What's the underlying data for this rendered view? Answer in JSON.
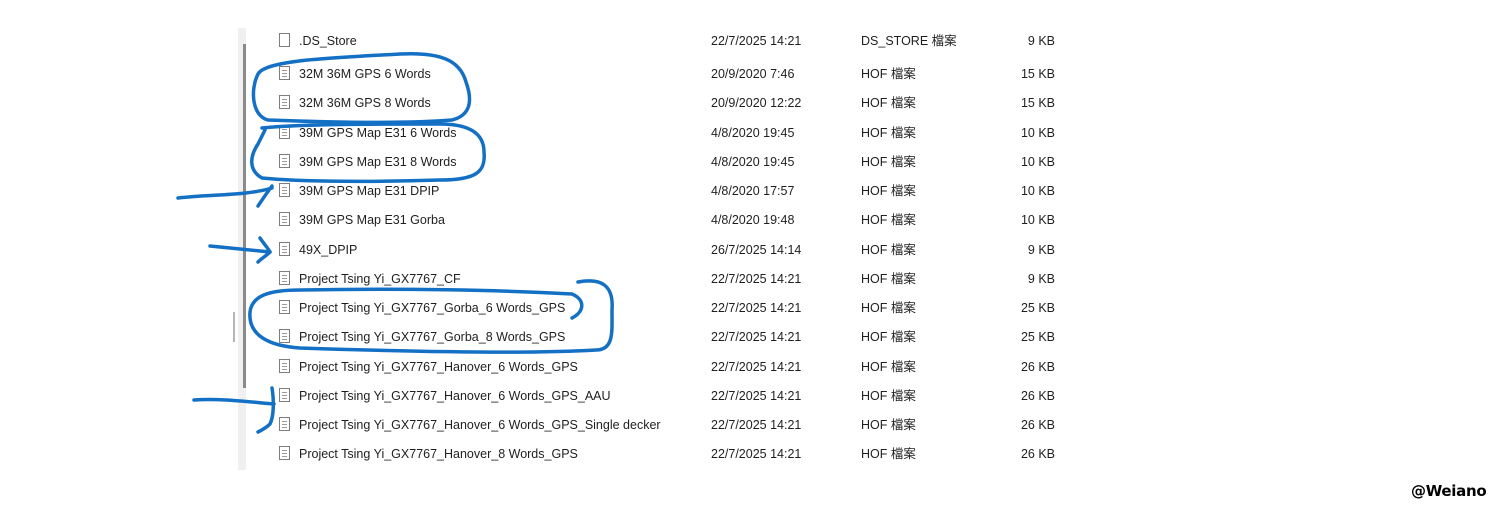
{
  "files": [
    {
      "name": ".DS_Store",
      "date": "22/7/2025 14:21",
      "type": "DS_STORE 檔案",
      "size": "9 KB",
      "icon": "blank-file-icon"
    },
    {
      "name": "32M 36M GPS 6 Words",
      "date": "20/9/2020 7:46",
      "type": "HOF 檔案",
      "size": "15 KB",
      "icon": "text-file-icon"
    },
    {
      "name": "32M 36M GPS 8 Words",
      "date": "20/9/2020 12:22",
      "type": "HOF 檔案",
      "size": "15 KB",
      "icon": "text-file-icon"
    },
    {
      "name": "39M GPS Map E31 6 Words",
      "date": "4/8/2020 19:45",
      "type": "HOF 檔案",
      "size": "10 KB",
      "icon": "text-file-icon"
    },
    {
      "name": "39M GPS Map E31 8 Words",
      "date": "4/8/2020 19:45",
      "type": "HOF 檔案",
      "size": "10 KB",
      "icon": "text-file-icon"
    },
    {
      "name": "39M GPS Map E31 DPIP",
      "date": "4/8/2020 17:57",
      "type": "HOF 檔案",
      "size": "10 KB",
      "icon": "text-file-icon"
    },
    {
      "name": "39M GPS Map E31 Gorba",
      "date": "4/8/2020 19:48",
      "type": "HOF 檔案",
      "size": "10 KB",
      "icon": "text-file-icon"
    },
    {
      "name": "49X_DPIP",
      "date": "26/7/2025 14:14",
      "type": "HOF 檔案",
      "size": "9 KB",
      "icon": "text-file-icon"
    },
    {
      "name": "Project Tsing Yi_GX7767_CF",
      "date": "22/7/2025 14:21",
      "type": "HOF 檔案",
      "size": "9 KB",
      "icon": "text-file-icon"
    },
    {
      "name": "Project Tsing Yi_GX7767_Gorba_6 Words_GPS",
      "date": "22/7/2025 14:21",
      "type": "HOF 檔案",
      "size": "25 KB",
      "icon": "text-file-icon"
    },
    {
      "name": "Project Tsing Yi_GX7767_Gorba_8 Words_GPS",
      "date": "22/7/2025 14:21",
      "type": "HOF 檔案",
      "size": "25 KB",
      "icon": "text-file-icon"
    },
    {
      "name": "Project Tsing Yi_GX7767_Hanover_6 Words_GPS",
      "date": "22/7/2025 14:21",
      "type": "HOF 檔案",
      "size": "26 KB",
      "icon": "text-file-icon"
    },
    {
      "name": "Project Tsing Yi_GX7767_Hanover_6 Words_GPS_AAU",
      "date": "22/7/2025 14:21",
      "type": "HOF 檔案",
      "size": "26 KB",
      "icon": "text-file-icon"
    },
    {
      "name": "Project Tsing Yi_GX7767_Hanover_6 Words_GPS_Single decker",
      "date": "22/7/2025 14:21",
      "type": "HOF 檔案",
      "size": "26 KB",
      "icon": "text-file-icon"
    },
    {
      "name": "Project Tsing Yi_GX7767_Hanover_8 Words_GPS",
      "date": "22/7/2025 14:21",
      "type": "HOF 檔案",
      "size": "26 KB",
      "icon": "text-file-icon"
    }
  ],
  "watermark": "@Weiano",
  "colors": {
    "annotation_ink": "#1370c4",
    "text": "#1f1f1f",
    "scrollbar_thumb": "#8a8a8a"
  }
}
